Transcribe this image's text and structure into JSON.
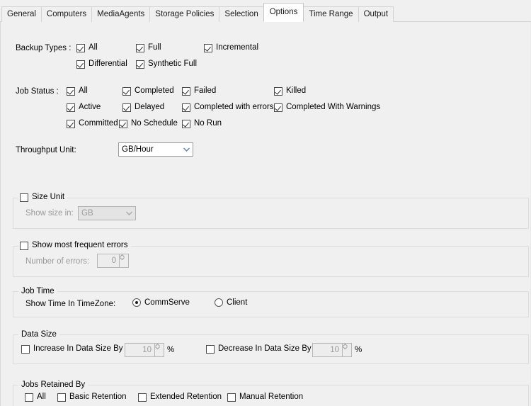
{
  "window": {
    "title": "Options"
  },
  "tabs": [
    {
      "label": "General",
      "active": false
    },
    {
      "label": "Computers",
      "active": false
    },
    {
      "label": "MediaAgents",
      "active": false
    },
    {
      "label": "Storage Policies",
      "active": false
    },
    {
      "label": "Selection",
      "active": false
    },
    {
      "label": "Options",
      "active": true
    },
    {
      "label": "Time Range",
      "active": false
    },
    {
      "label": "Output",
      "active": false
    }
  ],
  "backup_types": {
    "label": "Backup Types :",
    "options": [
      {
        "label": "All",
        "checked": true
      },
      {
        "label": "Full",
        "checked": true
      },
      {
        "label": "Incremental",
        "checked": true
      },
      {
        "label": "Differential",
        "checked": true
      },
      {
        "label": "Synthetic Full",
        "checked": true
      }
    ]
  },
  "job_status": {
    "label": "Job Status :",
    "options": [
      {
        "label": "All",
        "checked": true
      },
      {
        "label": "Completed",
        "checked": true
      },
      {
        "label": "Failed",
        "checked": true
      },
      {
        "label": "Killed",
        "checked": true
      },
      {
        "label": "Active",
        "checked": true
      },
      {
        "label": "Delayed",
        "checked": true
      },
      {
        "label": "Completed with errors",
        "checked": true
      },
      {
        "label": "Completed With Warnings",
        "checked": true
      },
      {
        "label": "Committed",
        "checked": true
      },
      {
        "label": "No Schedule",
        "checked": true
      },
      {
        "label": "No Run",
        "checked": true
      }
    ]
  },
  "throughput_unit": {
    "label": "Throughput Unit:",
    "value": "GB/Hour",
    "enabled": true
  },
  "size_unit": {
    "group_label": "Size Unit",
    "checked": false,
    "field_label": "Show size in:",
    "value": "GB",
    "enabled": false
  },
  "frequent_errors": {
    "group_label": "Show most frequent errors",
    "checked": false,
    "field_label": "Number of errors:",
    "value": "0",
    "enabled": false
  },
  "job_time": {
    "group_label": "Job Time",
    "field_label": "Show Time In TimeZone:",
    "options": [
      {
        "label": "CommServe",
        "selected": true
      },
      {
        "label": "Client",
        "selected": false
      }
    ]
  },
  "data_size": {
    "group_label": "Data Size",
    "increase": {
      "label": "Increase In Data Size By",
      "checked": false,
      "value": "10",
      "unit": "%",
      "enabled": false
    },
    "decrease": {
      "label": "Decrease In Data Size By",
      "checked": false,
      "value": "10",
      "unit": "%",
      "enabled": false
    }
  },
  "jobs_retained_by": {
    "group_label": "Jobs Retained By",
    "options": [
      {
        "label": "All",
        "checked": false
      },
      {
        "label": "Basic Retention",
        "checked": false
      },
      {
        "label": "Extended Retention",
        "checked": false
      },
      {
        "label": "Manual Retention",
        "checked": false
      }
    ]
  },
  "colors": {
    "background": "#f0f0f0",
    "active_tab": "#ffffff",
    "border": "#dcdcdc",
    "disabled_text": "#9a9a9a"
  }
}
